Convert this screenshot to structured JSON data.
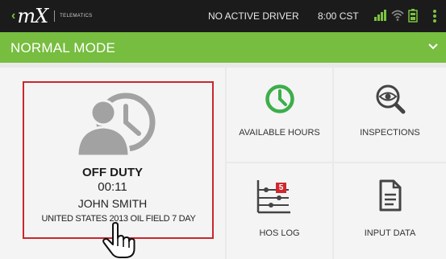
{
  "status_bar": {
    "logo_text": "mX",
    "logo_subtitle": "TELEMATICS",
    "driver_status": "NO ACTIVE DRIVER",
    "clock": "8:00 CST",
    "icons": [
      "signal-bars-icon",
      "wifi-icon",
      "battery-icon",
      "overflow-menu-icon"
    ]
  },
  "mode_bar": {
    "title": "NORMAL MODE",
    "icon": "chevron-down-icon"
  },
  "driver_panel": {
    "icon": "driver-clock-icon",
    "status": "OFF DUTY",
    "timer": "00:11",
    "driver_name": "JOHN SMITH",
    "ruleset": "UNITED STATES 2013 OIL FIELD 7 DAY"
  },
  "tiles": [
    {
      "label": "AVAILABLE HOURS",
      "icon": "clock-icon"
    },
    {
      "label": "INSPECTIONS",
      "icon": "inspection-eye-icon"
    },
    {
      "label": "HOS LOG",
      "icon": "hos-log-icon",
      "badge": "5"
    },
    {
      "label": "INPUT DATA",
      "icon": "document-icon"
    }
  ],
  "colors": {
    "status_bar_bg": "#1b1b1b",
    "mode_bar_bg": "#77bd40",
    "accent_green": "#3cae4a",
    "highlight_red": "#c9282d",
    "badge_red": "#d0282e"
  }
}
